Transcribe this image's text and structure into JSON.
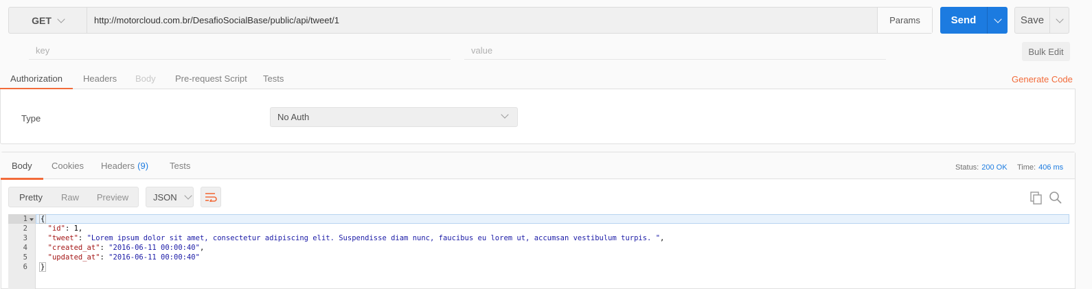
{
  "request": {
    "method": "GET",
    "url": "http://motorcloud.com.br/DesafioSocialBase/public/api/tweet/1",
    "params_label": "Params",
    "send_label": "Send",
    "save_label": "Save"
  },
  "params_editor": {
    "key_placeholder": "key",
    "value_placeholder": "value",
    "bulk_edit_label": "Bulk Edit"
  },
  "request_tabs": [
    {
      "label": "Authorization",
      "active": true
    },
    {
      "label": "Headers",
      "active": false
    },
    {
      "label": "Body",
      "active": false,
      "disabled": true
    },
    {
      "label": "Pre-request Script",
      "active": false
    },
    {
      "label": "Tests",
      "active": false
    }
  ],
  "generate_code_label": "Generate Code",
  "auth": {
    "type_label": "Type",
    "type_value": "No Auth"
  },
  "response_tabs": [
    {
      "label": "Body",
      "active": true
    },
    {
      "label": "Cookies",
      "active": false
    },
    {
      "label": "Headers",
      "count": "(9)",
      "active": false
    },
    {
      "label": "Tests",
      "active": false
    }
  ],
  "response_status": {
    "status_label": "Status:",
    "status_value": "200 OK",
    "time_label": "Time:",
    "time_value": "406 ms"
  },
  "view_modes": [
    {
      "label": "Pretty",
      "active": true
    },
    {
      "label": "Raw",
      "active": false
    },
    {
      "label": "Preview",
      "active": false
    }
  ],
  "format_label": "JSON",
  "code_lines": [
    {
      "num": "1",
      "parts": [
        {
          "t": "{",
          "c": "n"
        }
      ]
    },
    {
      "num": "2",
      "parts": [
        {
          "t": "  ",
          "c": "n"
        },
        {
          "t": "\"id\"",
          "c": "k"
        },
        {
          "t": ": 1,",
          "c": "n"
        }
      ]
    },
    {
      "num": "3",
      "parts": [
        {
          "t": "  ",
          "c": "n"
        },
        {
          "t": "\"tweet\"",
          "c": "k"
        },
        {
          "t": ": ",
          "c": "n"
        },
        {
          "t": "\"Lorem ipsum dolor sit amet, consectetur adipiscing elit. Suspendisse diam nunc, faucibus eu lorem ut, accumsan vestibulum turpis. \"",
          "c": "s"
        },
        {
          "t": ",",
          "c": "n"
        }
      ]
    },
    {
      "num": "4",
      "parts": [
        {
          "t": "  ",
          "c": "n"
        },
        {
          "t": "\"created_at\"",
          "c": "k"
        },
        {
          "t": ": ",
          "c": "n"
        },
        {
          "t": "\"2016-06-11 00:00:40\"",
          "c": "s"
        },
        {
          "t": ",",
          "c": "n"
        }
      ]
    },
    {
      "num": "5",
      "parts": [
        {
          "t": "  ",
          "c": "n"
        },
        {
          "t": "\"updated_at\"",
          "c": "k"
        },
        {
          "t": ": ",
          "c": "n"
        },
        {
          "t": "\"2016-06-11 00:00:40\"",
          "c": "s"
        }
      ]
    },
    {
      "num": "6",
      "parts": [
        {
          "t": "}",
          "c": "n"
        }
      ]
    }
  ],
  "colors": {
    "accent_orange": "#f26b3a",
    "send_blue": "#1c7be0"
  }
}
